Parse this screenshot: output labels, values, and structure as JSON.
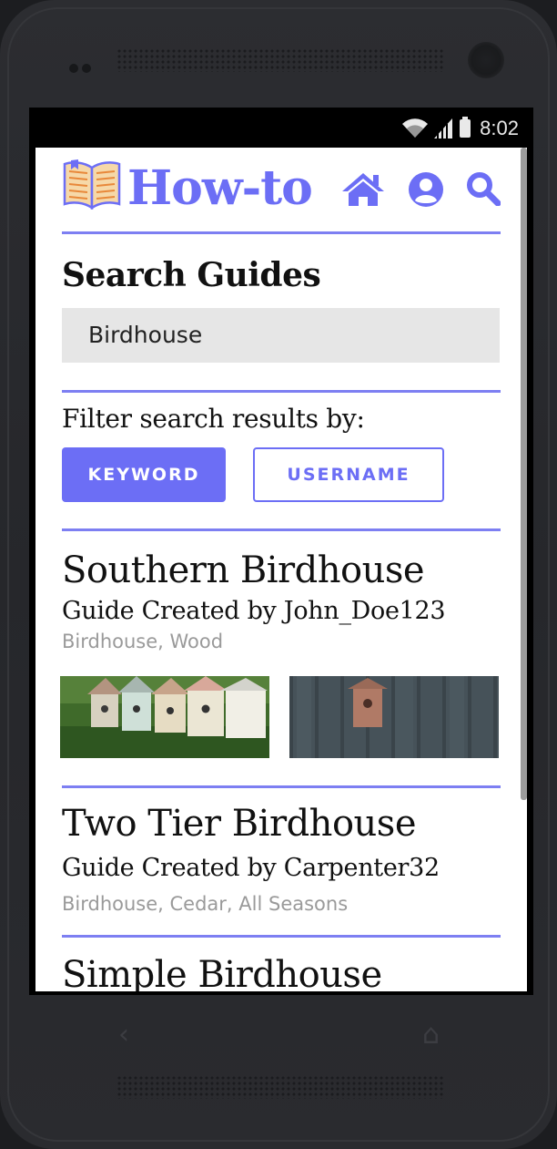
{
  "status_bar": {
    "time": "8:02",
    "icons": [
      "wifi-icon",
      "signal-icon",
      "battery-icon"
    ]
  },
  "header": {
    "logo_icon": "open-book-icon",
    "app_name": "How-to",
    "nav_icons": [
      "home-icon",
      "user-icon",
      "search-icon"
    ]
  },
  "colors": {
    "accent": "#6c6ef5",
    "rule": "#7d7ff2",
    "search_bg": "#e6e6e6",
    "tag_text": "#9a9a9a"
  },
  "search": {
    "heading": "Search Guides",
    "value": "Birdhouse"
  },
  "filter": {
    "label": "Filter search results by:",
    "options": [
      {
        "label": "KEYWORD",
        "selected": true
      },
      {
        "label": "USERNAME",
        "selected": false
      }
    ]
  },
  "results": [
    {
      "title": "Southern Birdhouse",
      "creator": "Guide Created by John_Doe123",
      "tags": "Birdhouse, Wood",
      "images": [
        "row-of-painted-birdhouses-photo",
        "birdhouse-on-wooden-fence-photo"
      ]
    },
    {
      "title": "Two Tier Birdhouse",
      "creator": "Guide Created by Carpenter32",
      "tags": "Birdhouse, Cedar, All Seasons"
    },
    {
      "title": "Simple Birdhouse"
    }
  ],
  "device_nav": [
    "back-icon",
    "home-button-icon"
  ]
}
